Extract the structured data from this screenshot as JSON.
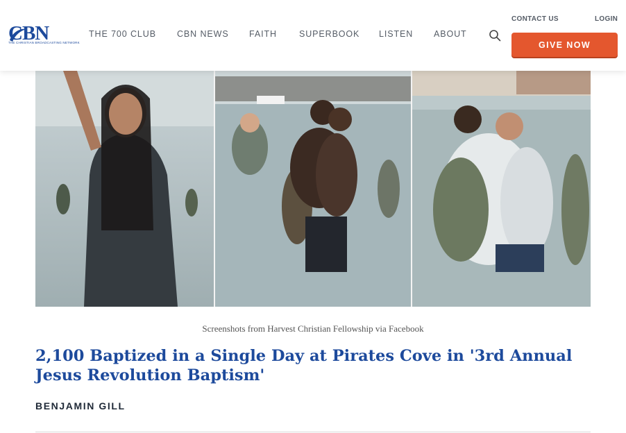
{
  "header": {
    "logo_text": "CBN",
    "logo_tagline": "THE CHRISTIAN BROADCASTING NETWORK",
    "nav": [
      {
        "label": "THE 700 CLUB"
      },
      {
        "label": "CBN NEWS"
      },
      {
        "label": "FAITH"
      },
      {
        "label": "SUPERBOOK"
      },
      {
        "label": "LISTEN"
      },
      {
        "label": "ABOUT"
      }
    ],
    "search_icon": "search-icon",
    "contact_label": "CONTACT US",
    "login_label": "LOGIN",
    "give_label": "GIVE NOW",
    "brand_color": "#1d4a9c",
    "accent_color": "#e4572e"
  },
  "article": {
    "caption": "Screenshots from Harvest Christian Fellowship via Facebook",
    "headline": "2,100 Baptized in a Single Day at Pirates Cove in '3rd Annual Jesus Revolution Baptism'",
    "author": "BENJAMIN GILL"
  }
}
